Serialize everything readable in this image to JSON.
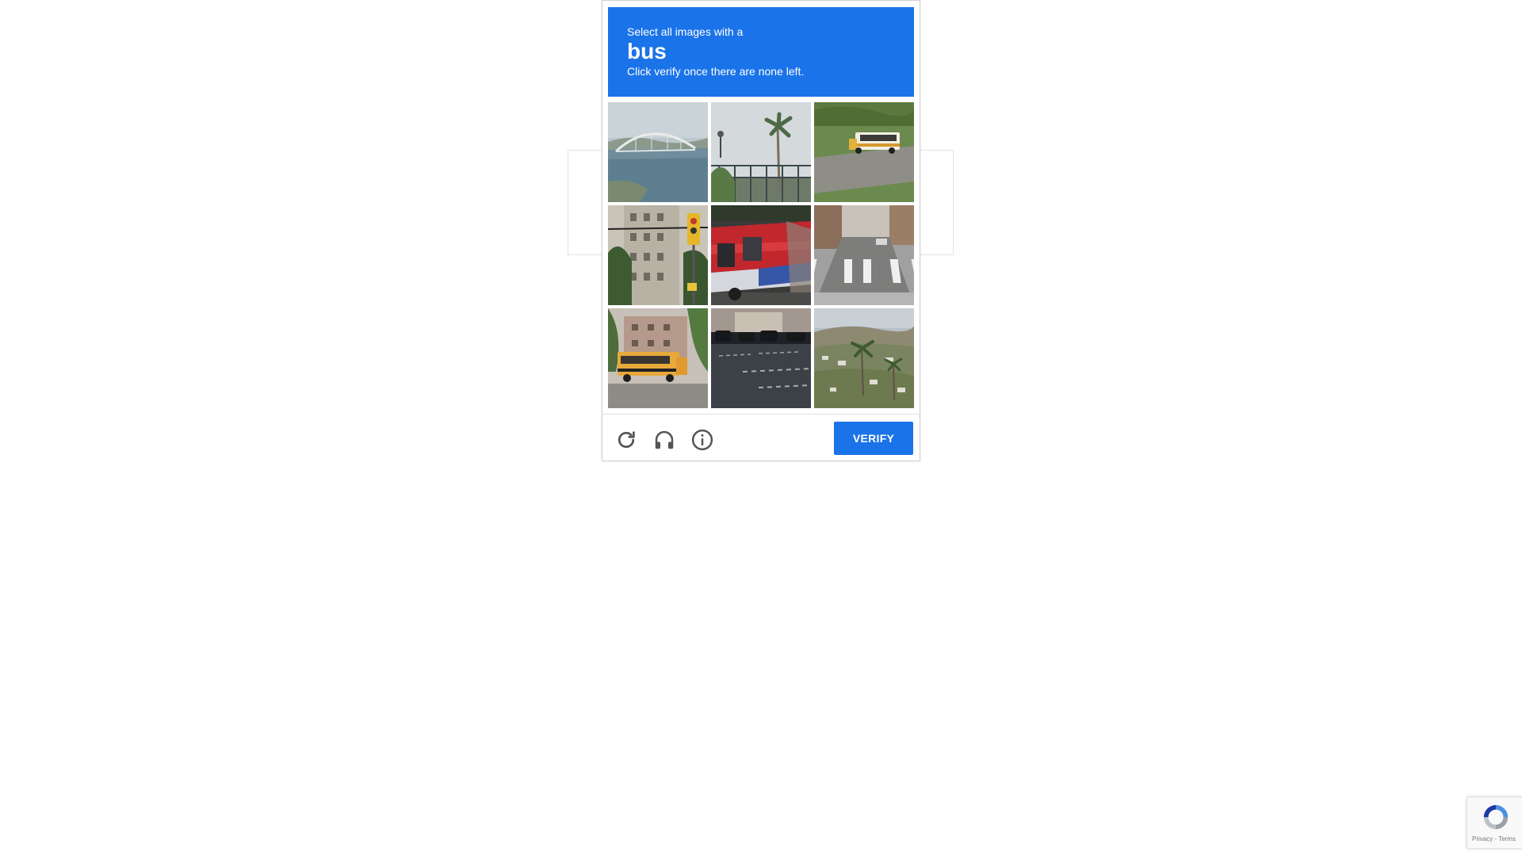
{
  "challenge": {
    "instruction_line1": "Select all images with a",
    "target": "bus",
    "instruction_line2": "Click verify once there are none left.",
    "header_color": "#1a73e8"
  },
  "tiles": [
    {
      "row": 1,
      "col": 1,
      "content": "bridge over river"
    },
    {
      "row": 1,
      "col": 2,
      "content": "palm tree and fence"
    },
    {
      "row": 1,
      "col": 3,
      "content": "school bus on road"
    },
    {
      "row": 2,
      "col": 1,
      "content": "building with traffic light"
    },
    {
      "row": 2,
      "col": 2,
      "content": "red and blue bus"
    },
    {
      "row": 2,
      "col": 3,
      "content": "street crosswalk"
    },
    {
      "row": 3,
      "col": 1,
      "content": "school bus near building"
    },
    {
      "row": 3,
      "col": 2,
      "content": "street with parked cars"
    },
    {
      "row": 3,
      "col": 3,
      "content": "hillside with palm trees"
    }
  ],
  "footer": {
    "reload_icon": "reload-icon",
    "audio_icon": "headphones-icon",
    "info_icon": "info-icon",
    "verify_label": "VERIFY",
    "verify_color": "#1a73e8"
  },
  "badge": {
    "logo_icon": "recaptcha-logo-icon",
    "terms_text": "Privacy - Terms"
  }
}
